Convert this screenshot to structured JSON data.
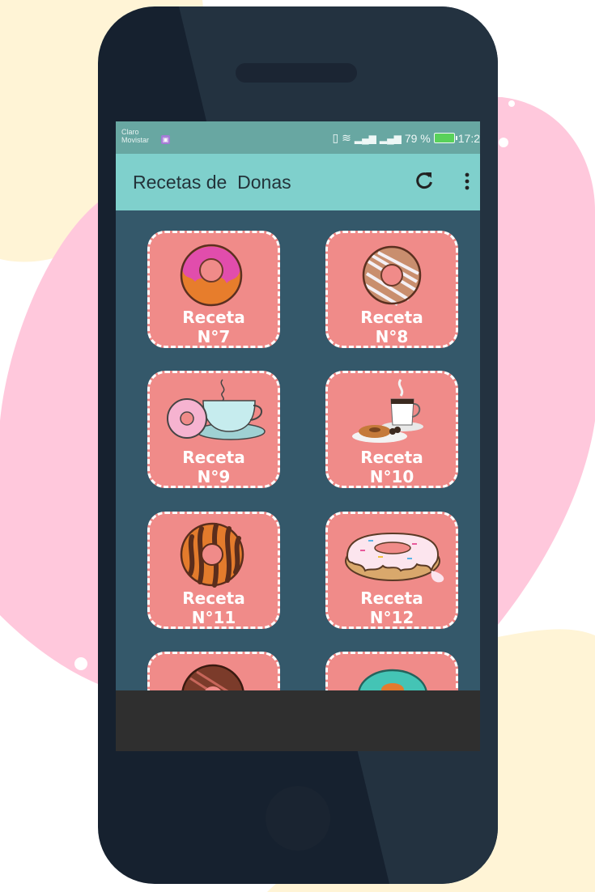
{
  "status": {
    "carrier_line1": "Claro",
    "carrier_line2": "Movistar",
    "battery": "79 %",
    "time": "17:2"
  },
  "appbar": {
    "title": "Recetas de  Donas"
  },
  "icons": {
    "refresh": "refresh-icon",
    "overflow": "more-vert-icon"
  },
  "colors": {
    "appbar": "#7fd0cc",
    "statusbar": "#68a7a2",
    "card": "#f08b89",
    "screen_bg": "#34586a"
  },
  "recipes": [
    {
      "label1": "Receta",
      "label2": "N°7",
      "image": "pink-sprinkle-donut"
    },
    {
      "label1": "Receta",
      "label2": "N°8",
      "image": "drizzle-donut"
    },
    {
      "label1": "Receta",
      "label2": "N°9",
      "image": "donut-and-teacup"
    },
    {
      "label1": "Receta",
      "label2": "N°10",
      "image": "coffee-and-donut"
    },
    {
      "label1": "Receta",
      "label2": "N°11",
      "image": "chocolate-stripe-donut"
    },
    {
      "label1": "Receta",
      "label2": "N°12",
      "image": "melting-glazed-donut"
    },
    {
      "label1": "",
      "label2": "",
      "image": "dark-glazed-donut"
    },
    {
      "label1": "",
      "label2": "",
      "image": "teal-glazed-donut"
    }
  ]
}
